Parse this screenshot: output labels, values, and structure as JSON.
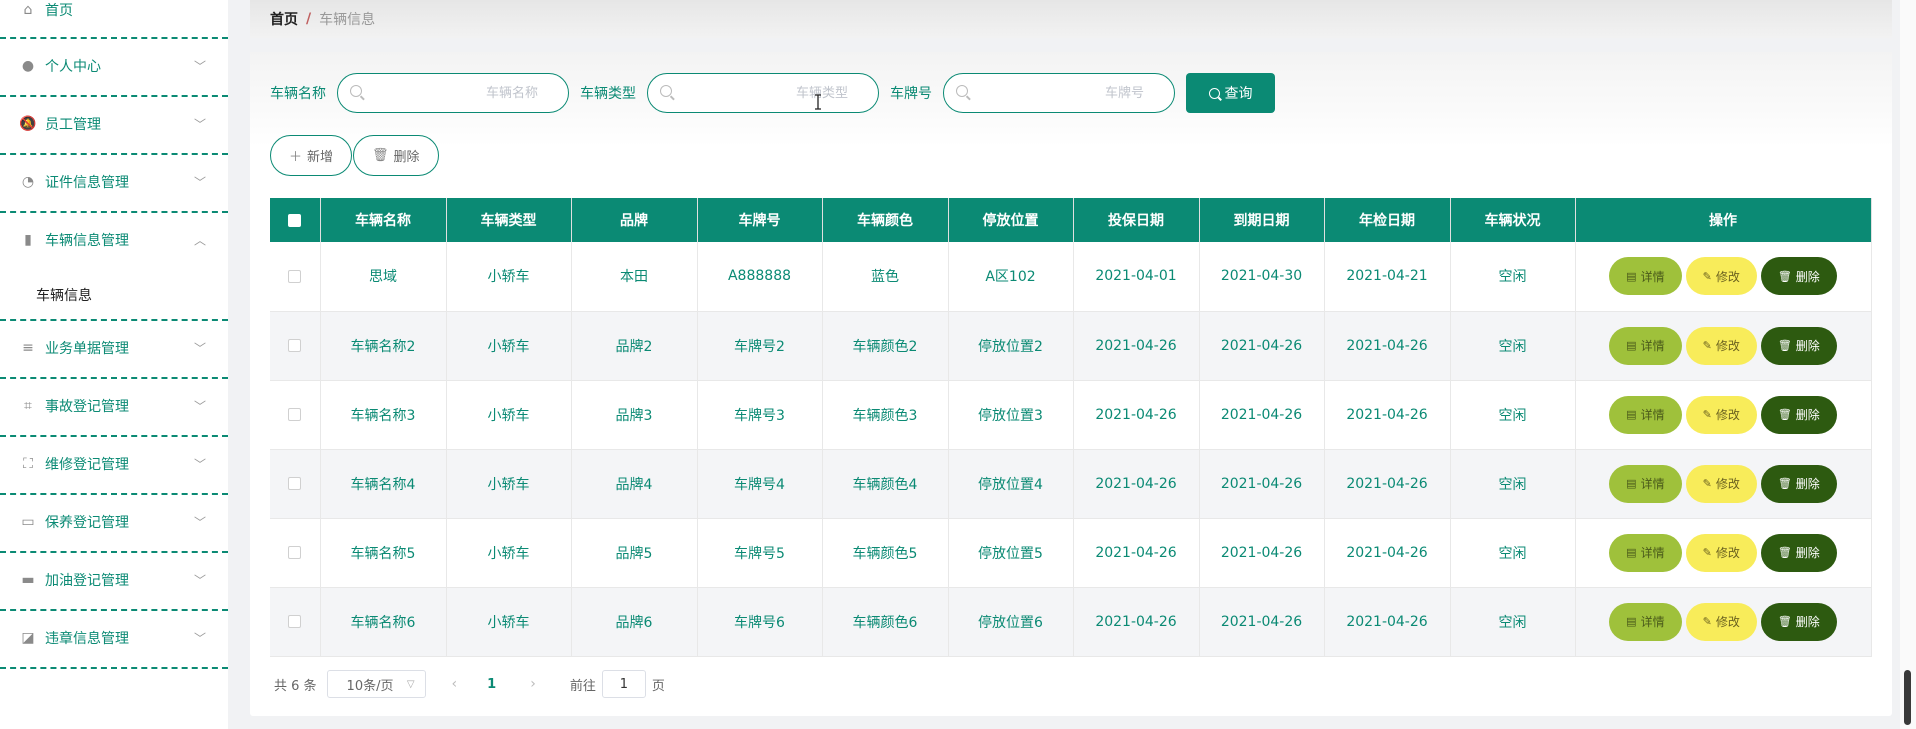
{
  "sidebar": {
    "items": [
      {
        "label": "首页",
        "icon": "home-icon"
      },
      {
        "label": "个人中心",
        "icon": "user-icon"
      },
      {
        "label": "员工管理",
        "icon": "bell-off-icon"
      },
      {
        "label": "证件信息管理",
        "icon": "gauge-icon"
      },
      {
        "label": "车辆信息管理",
        "icon": "bar-chart-icon"
      },
      {
        "label": "业务单据管理",
        "icon": "list-icon"
      },
      {
        "label": "事故登记管理",
        "icon": "crop-icon"
      },
      {
        "label": "维修登记管理",
        "icon": "fullscreen-icon"
      },
      {
        "label": "保养登记管理",
        "icon": "postcard-icon"
      },
      {
        "label": "加油登记管理",
        "icon": "briefcase-icon"
      },
      {
        "label": "违章信息管理",
        "icon": "line-chart-icon"
      }
    ],
    "sub_item": "车辆信息"
  },
  "breadcrumb": {
    "home": "首页",
    "sep": "/",
    "current": "车辆信息"
  },
  "search": {
    "name_label": "车辆名称",
    "name_placeholder": "车辆名称",
    "type_label": "车辆类型",
    "type_placeholder": "车辆类型",
    "plate_label": "车牌号",
    "plate_placeholder": "车牌号",
    "query_label": "查询"
  },
  "actions": {
    "add_label": "新增",
    "delete_label": "删除"
  },
  "table": {
    "headers": [
      "车辆名称",
      "车辆类型",
      "品牌",
      "车牌号",
      "车辆颜色",
      "停放位置",
      "投保日期",
      "到期日期",
      "年检日期",
      "车辆状况",
      "操作"
    ],
    "rows": [
      [
        "思域",
        "小轿车",
        "本田",
        "A888888",
        "蓝色",
        "A区102",
        "2021-04-01",
        "2021-04-30",
        "2021-04-21",
        "空闲"
      ],
      [
        "车辆名称2",
        "小轿车",
        "品牌2",
        "车牌号2",
        "车辆颜色2",
        "停放位置2",
        "2021-04-26",
        "2021-04-26",
        "2021-04-26",
        "空闲"
      ],
      [
        "车辆名称3",
        "小轿车",
        "品牌3",
        "车牌号3",
        "车辆颜色3",
        "停放位置3",
        "2021-04-26",
        "2021-04-26",
        "2021-04-26",
        "空闲"
      ],
      [
        "车辆名称4",
        "小轿车",
        "品牌4",
        "车牌号4",
        "车辆颜色4",
        "停放位置4",
        "2021-04-26",
        "2021-04-26",
        "2021-04-26",
        "空闲"
      ],
      [
        "车辆名称5",
        "小轿车",
        "品牌5",
        "车牌号5",
        "车辆颜色5",
        "停放位置5",
        "2021-04-26",
        "2021-04-26",
        "2021-04-26",
        "空闲"
      ],
      [
        "车辆名称6",
        "小轿车",
        "品牌6",
        "车牌号6",
        "车辆颜色6",
        "停放位置6",
        "2021-04-26",
        "2021-04-26",
        "2021-04-26",
        "空闲"
      ]
    ],
    "ops": {
      "detail": "详情",
      "edit": "修改",
      "delete": "删除"
    }
  },
  "pager": {
    "total": "共 6 条",
    "page_size": "10条/页",
    "current": "1",
    "goto": "前往",
    "goto_value": "1",
    "page_unit": "页"
  },
  "colors": {
    "primary": "#0b8a74",
    "detail": "#9fc13b",
    "edit": "#f8ec5a",
    "delete": "#2d5a10"
  }
}
